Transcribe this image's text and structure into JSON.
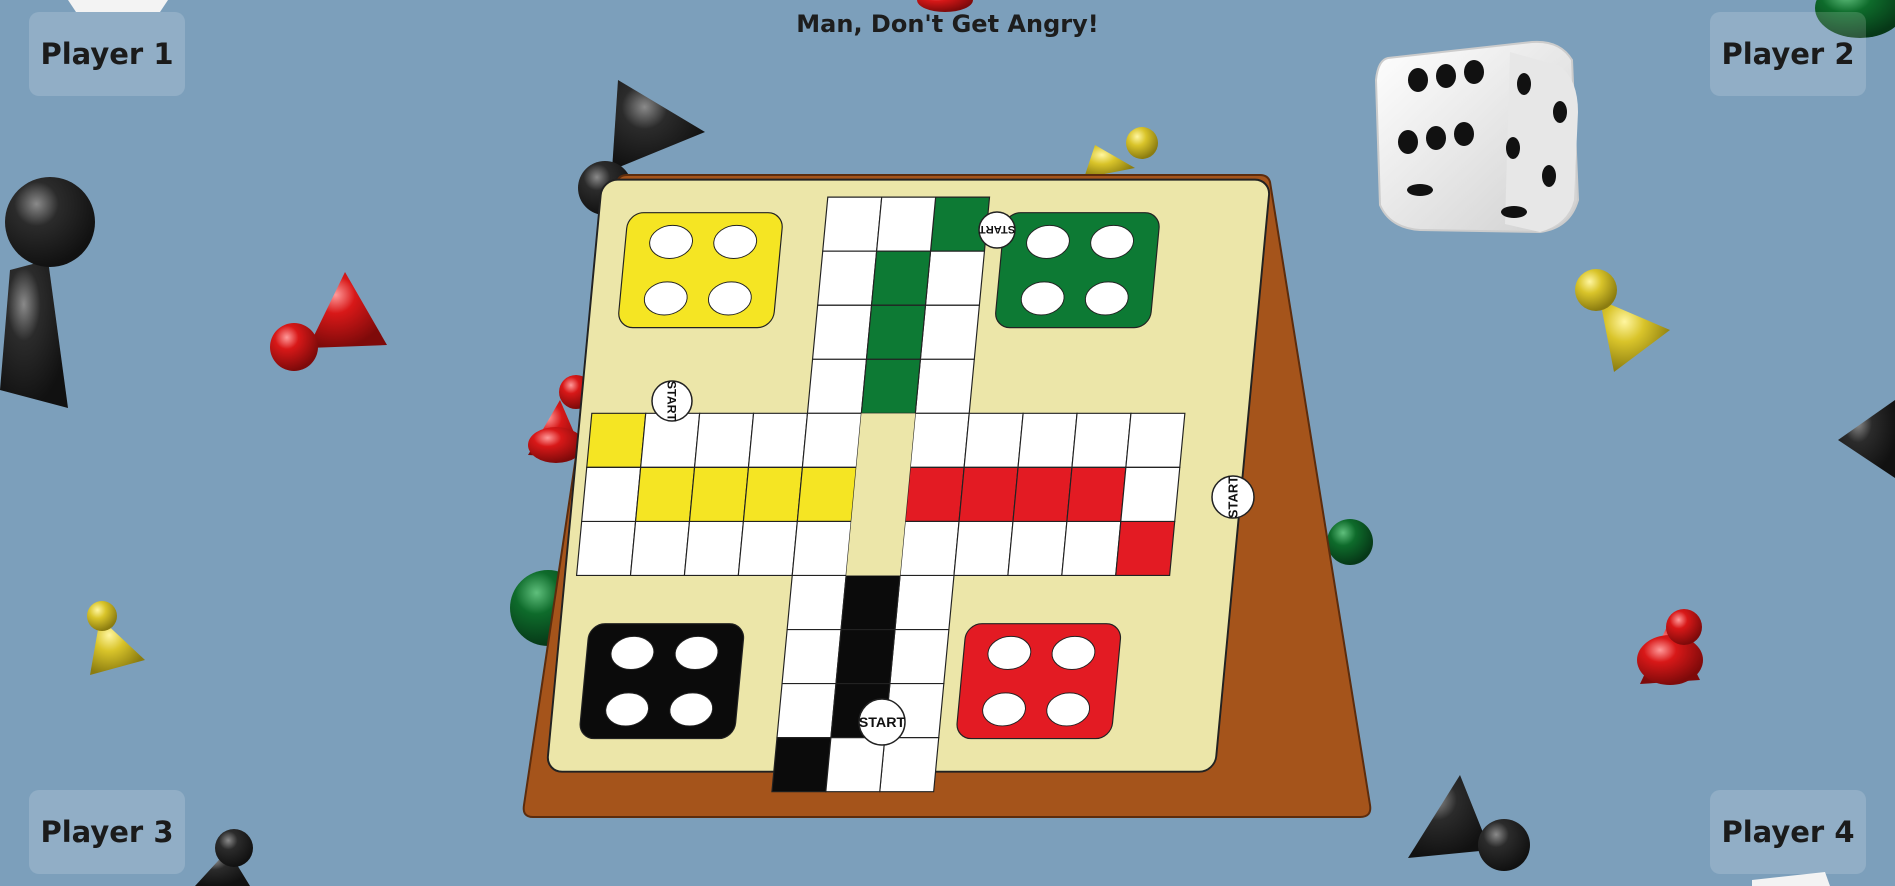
{
  "title": "Man, Don't Get Angry!",
  "players": [
    {
      "label": "Player 1"
    },
    {
      "label": "Player 2"
    },
    {
      "label": "Player 3"
    },
    {
      "label": "Player 4"
    }
  ],
  "start_label": "START",
  "colors": {
    "background": "#7c9fbb",
    "board_frame": "#a5541b",
    "board_surface": "#ece6a9",
    "yellow": "#f5e523",
    "green": "#0d7a34",
    "red": "#e31b23",
    "black": "#0b0b0b",
    "white": "#ffffff"
  },
  "dice": {
    "visible_face": 6
  }
}
